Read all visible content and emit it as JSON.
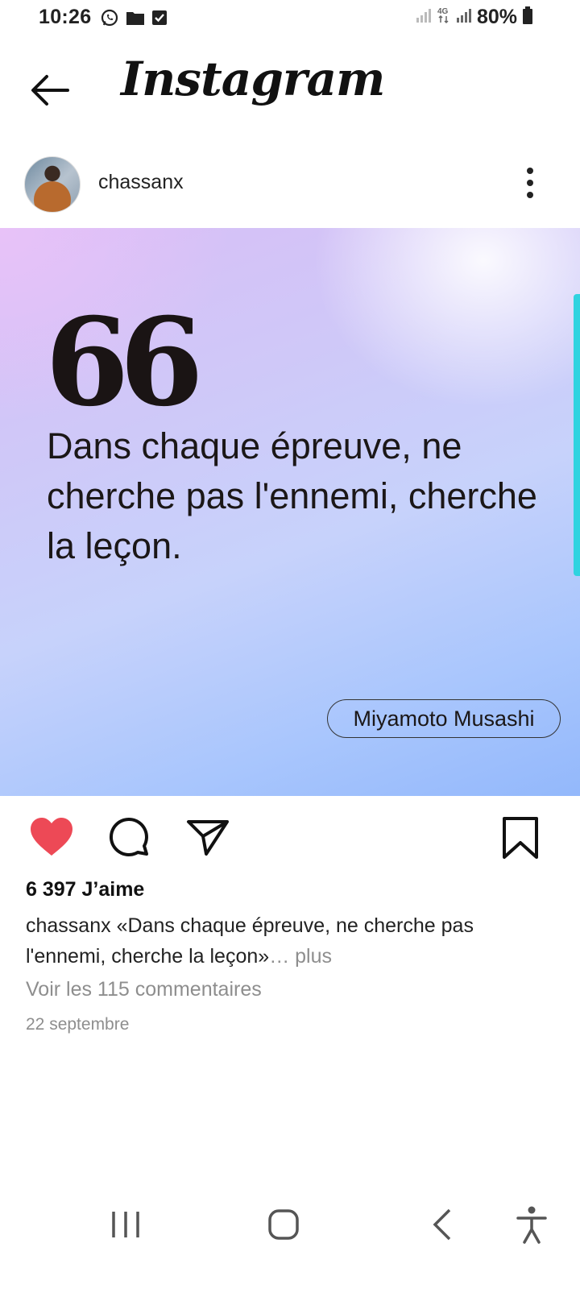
{
  "status_bar": {
    "time": "10:26",
    "battery": "80%"
  },
  "header": {
    "app_name": "Instagram"
  },
  "post": {
    "username": "chassanx",
    "image": {
      "quote_mark": "66",
      "quote": "Dans chaque épreuve, ne cherche pas l'ennemi, cherche la leçon.",
      "author": "Miyamoto Musashi"
    },
    "likes": "6 397 J’aime",
    "caption_user": "chassanx",
    "caption_text": "«Dans chaque épreuve, ne cherche pas l'ennemi, cherche la leçon»",
    "caption_more": "… plus",
    "comments_link": "Voir les 115 commentaires",
    "date": "22 septembre"
  },
  "colors": {
    "like": "#ed4956",
    "muted": "#8e8e8e",
    "accent": "#2fd3e0"
  }
}
